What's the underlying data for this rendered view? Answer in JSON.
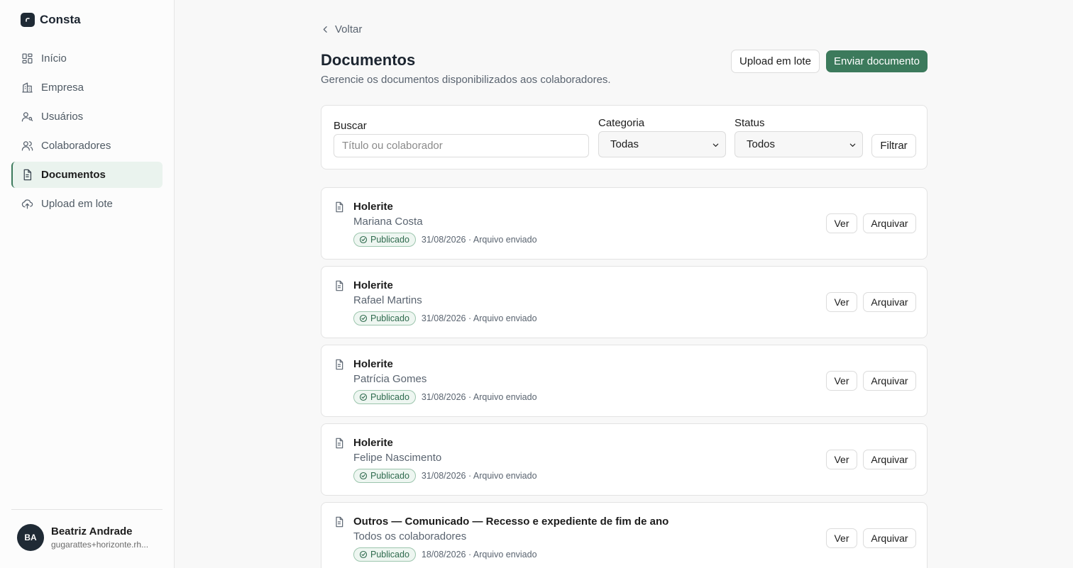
{
  "brand": {
    "name": "Consta"
  },
  "sidebar": {
    "items": [
      {
        "label": "Início",
        "icon": "grid-icon"
      },
      {
        "label": "Empresa",
        "icon": "building-icon"
      },
      {
        "label": "Usuários",
        "icon": "user-key-icon"
      },
      {
        "label": "Colaboradores",
        "icon": "users-icon"
      },
      {
        "label": "Documentos",
        "icon": "document-icon",
        "active": true
      },
      {
        "label": "Upload em lote",
        "icon": "cloud-upload-icon"
      }
    ]
  },
  "user": {
    "initials": "BA",
    "name": "Beatriz Andrade",
    "email": "gugarattes+horizonte.rh..."
  },
  "header": {
    "back_label": "Voltar",
    "title": "Documentos",
    "subtitle": "Gerencie os documentos disponibilizados aos colaboradores.",
    "upload_label": "Upload em lote",
    "send_label": "Enviar documento"
  },
  "filters": {
    "search_label": "Buscar",
    "search_placeholder": "Título ou colaborador",
    "category_label": "Categoria",
    "category_value": "Todas",
    "status_label": "Status",
    "status_value": "Todos",
    "filter_label": "Filtrar"
  },
  "documents": [
    {
      "title": "Holerite",
      "person": "Mariana Costa",
      "status": "Publicado",
      "meta": "31/08/2026 · Arquivo enviado"
    },
    {
      "title": "Holerite",
      "person": "Rafael Martins",
      "status": "Publicado",
      "meta": "31/08/2026 · Arquivo enviado"
    },
    {
      "title": "Holerite",
      "person": "Patrícia Gomes",
      "status": "Publicado",
      "meta": "31/08/2026 · Arquivo enviado"
    },
    {
      "title": "Holerite",
      "person": "Felipe Nascimento",
      "status": "Publicado",
      "meta": "31/08/2026 · Arquivo enviado"
    },
    {
      "title": "Outros — Comunicado — Recesso e expediente de fim de ano",
      "person": "Todos os colaboradores",
      "status": "Publicado",
      "meta": "18/08/2026 · Arquivo enviado"
    }
  ],
  "actions": {
    "view_label": "Ver",
    "archive_label": "Arquivar"
  },
  "colors": {
    "accent": "#3c7a5c",
    "badge_bg": "#eef6f1",
    "active_nav_bg": "#eaf3ee",
    "dark": "#1f2a35"
  }
}
